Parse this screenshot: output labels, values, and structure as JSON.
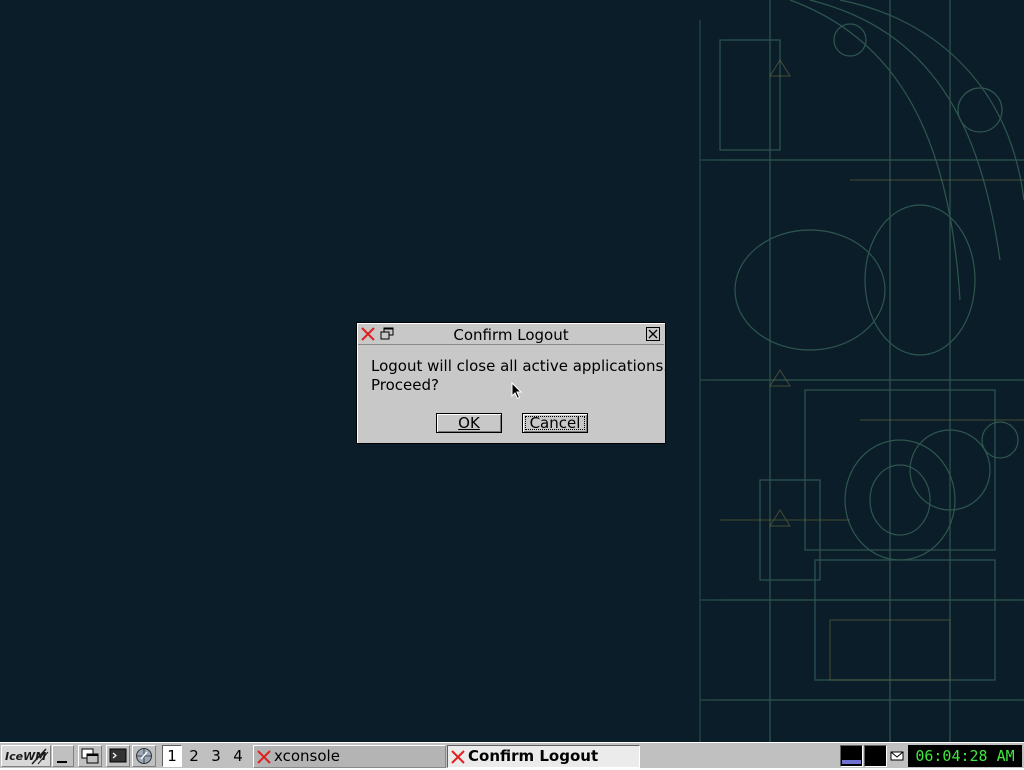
{
  "dialog": {
    "title": "Confirm Logout",
    "message": "Logout will close all active applications.\nProceed?",
    "ok_label": "OK",
    "cancel_label": "Cancel"
  },
  "taskbar": {
    "start_logo": "IceWM",
    "workspaces": [
      "1",
      "2",
      "3",
      "4"
    ],
    "active_workspace": "1",
    "tasks": [
      {
        "label": "xconsole",
        "active": false
      },
      {
        "label": "Confirm Logout",
        "active": true
      }
    ],
    "clock": "06:04:28 AM"
  },
  "icons": {
    "dialog_app": "x-logo-icon",
    "dialog_menu": "window-menu-icon",
    "dialog_close": "close-icon",
    "show_desktop": "show-desktop-icon",
    "window_list": "window-list-icon",
    "terminal": "terminal-icon",
    "browser": "browser-icon",
    "mail": "mail-icon"
  },
  "colors": {
    "desktop_bg": "#0c1d2a",
    "clock_text": "#3ee83e",
    "x_logo": "#e02020"
  }
}
